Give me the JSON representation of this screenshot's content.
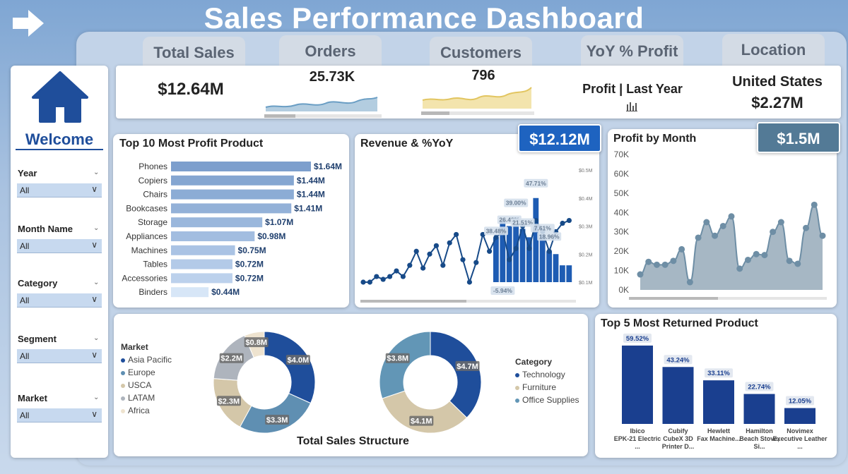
{
  "header": {
    "title": "Sales Performance Dashboard"
  },
  "tabs": [
    "Total Sales",
    "Orders",
    "Customers",
    "YoY % Profit",
    "Location"
  ],
  "kpis": {
    "total_sales": "$12.64M",
    "orders": "25.73K",
    "customers": "796",
    "profit_last_year": "Profit | Last Year",
    "location_country": "United States",
    "location_value": "$2.27M"
  },
  "sidebar": {
    "welcome": "Welcome",
    "filters": [
      {
        "label": "Year",
        "value": "All"
      },
      {
        "label": "Month Name",
        "value": "All"
      },
      {
        "label": "Category",
        "value": "All"
      },
      {
        "label": "Segment",
        "value": "All"
      },
      {
        "label": "Market",
        "value": "All"
      }
    ]
  },
  "cards": {
    "top10_title": "Top 10 Most Profit Product",
    "revenue_title": "Revenue & %YoY",
    "revenue_badge": "$12.12M",
    "profit_month_title": "Profit by Month",
    "profit_month_badge": "$1.5M",
    "structure_title": "Total Sales Structure",
    "returned_title": "Top 5 Most Returned Product"
  },
  "colors": {
    "navy": "#1f4e9b",
    "bar_blue": "#1e5cb3",
    "returned_blue": "#1a3f8f",
    "area_fill": "#a6b7c4",
    "area_line": "#6e8ea5"
  },
  "chart_data": [
    {
      "type": "bar",
      "id": "top10",
      "categories": [
        "Phones",
        "Copiers",
        "Chairs",
        "Bookcases",
        "Storage",
        "Appliances",
        "Machines",
        "Tables",
        "Accessories",
        "Binders"
      ],
      "values": [
        1.64,
        1.44,
        1.44,
        1.41,
        1.07,
        0.98,
        0.75,
        0.72,
        0.72,
        0.44
      ],
      "labels": [
        "$1.64M",
        "$1.44M",
        "$1.44M",
        "$1.41M",
        "$1.07M",
        "$0.98M",
        "$0.75M",
        "$0.72M",
        "$0.72M",
        "$0.44M"
      ],
      "title": "Top 10 Most Profit Product"
    },
    {
      "type": "line",
      "id": "revenue",
      "title": "Revenue & %YoY",
      "y_ticks": [
        "$0.5M",
        "$0.4M",
        "$0.3M",
        "$0.2M",
        "$0.1M"
      ],
      "ylim": [
        0.1,
        0.5
      ],
      "line_values": [
        0.1,
        0.1,
        0.12,
        0.11,
        0.12,
        0.14,
        0.12,
        0.16,
        0.21,
        0.15,
        0.2,
        0.23,
        0.16,
        0.24,
        0.27,
        0.18,
        0.1,
        0.17,
        0.27,
        0.21,
        0.26,
        0.28,
        0.18,
        0.22,
        0.3,
        0.22,
        0.32,
        0.28,
        0.21,
        0.28,
        0.31,
        0.32
      ],
      "bars": {
        "start_index": 20,
        "values": [
          0.26,
          0.32,
          0.3,
          0.33,
          0.29,
          0.26,
          0.4,
          0.27,
          0.21,
          0.2,
          0.16,
          0.16
        ],
        "yoy_labels": [
          "38.48%",
          "-5.94%",
          "26.49%",
          "39.00%",
          "21.51%",
          "47.71%",
          "7.61%",
          "18.96%"
        ],
        "yoy_positions": [
          20,
          21,
          22,
          23,
          24,
          26,
          27,
          28
        ]
      }
    },
    {
      "type": "area",
      "id": "profit_month",
      "title": "Profit by Month",
      "y_ticks": [
        "70K",
        "60K",
        "50K",
        "40K",
        "30K",
        "20K",
        "10K",
        "0K"
      ],
      "ylim": [
        0,
        70000
      ],
      "values": [
        8000,
        14500,
        13000,
        13000,
        15000,
        21000,
        4000,
        27000,
        35000,
        28000,
        33000,
        38000,
        11000,
        15500,
        18500,
        18000,
        30000,
        35000,
        15000,
        13500,
        32000,
        44000,
        28000
      ]
    },
    {
      "type": "pie",
      "id": "market",
      "legend_title": "Market",
      "categories": [
        "Asia Pacific",
        "Europe",
        "USCA",
        "LATAM",
        "Africa"
      ],
      "values": [
        4.0,
        3.3,
        2.3,
        2.2,
        0.8
      ],
      "labels": [
        "$4.0M",
        "$3.3M",
        "$2.3M",
        "$2.2M",
        "$0.8M"
      ],
      "colors": [
        "#1f4e9b",
        "#5f8fb2",
        "#d4c7a9",
        "#aeb4bd",
        "#eee3cf"
      ]
    },
    {
      "type": "pie",
      "id": "category",
      "legend_title": "Category",
      "categories": [
        "Technology",
        "Furniture",
        "Office Supplies"
      ],
      "values": [
        4.7,
        4.1,
        3.8
      ],
      "labels": [
        "$4.7M",
        "$4.1M",
        "$3.8M"
      ],
      "colors": [
        "#1f4e9b",
        "#d4c7a9",
        "#6296b6"
      ]
    },
    {
      "type": "bar",
      "id": "returned",
      "title": "Top 5 Most Returned Product",
      "categories": [
        "Ibico EPK-21 Electric ...",
        "Cubify CubeX 3D Printer D...",
        "Hewlett Fax Machine...",
        "Hamilton Beach Stove, Si...",
        "Novimex Executive Leather ..."
      ],
      "values": [
        59.52,
        43.24,
        33.11,
        22.74,
        12.05
      ],
      "labels": [
        "59.52%",
        "43.24%",
        "33.11%",
        "22.74%",
        "12.05%"
      ],
      "ylim": [
        0,
        60
      ]
    }
  ]
}
